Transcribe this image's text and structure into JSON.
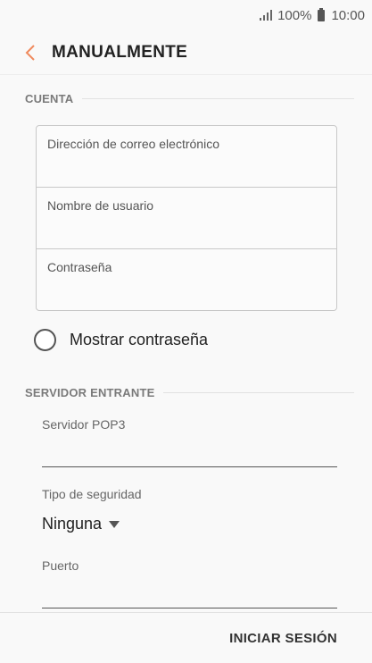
{
  "status_bar": {
    "battery_text": "100%",
    "time": "10:00"
  },
  "app_bar": {
    "back_icon": "chevron-left-icon",
    "title": "MANUALMENTE",
    "accent_color": "#f08a5d"
  },
  "account_section": {
    "header": "CUENTA",
    "fields": [
      {
        "placeholder": "Dirección de correo electrónico",
        "value": ""
      },
      {
        "placeholder": "Nombre de usuario",
        "value": ""
      },
      {
        "placeholder": "Contraseña",
        "value": ""
      }
    ],
    "show_password": {
      "label": "Mostrar contraseña",
      "checked": false
    }
  },
  "incoming_server_section": {
    "header": "SERVIDOR ENTRANTE",
    "pop3_server": {
      "label": "Servidor POP3",
      "value": ""
    },
    "security_type": {
      "label": "Tipo de seguridad",
      "selected": "Ninguna"
    },
    "port": {
      "label": "Puerto",
      "value": ""
    }
  },
  "bottom_bar": {
    "sign_in_label": "INICIAR SESIÓN"
  }
}
